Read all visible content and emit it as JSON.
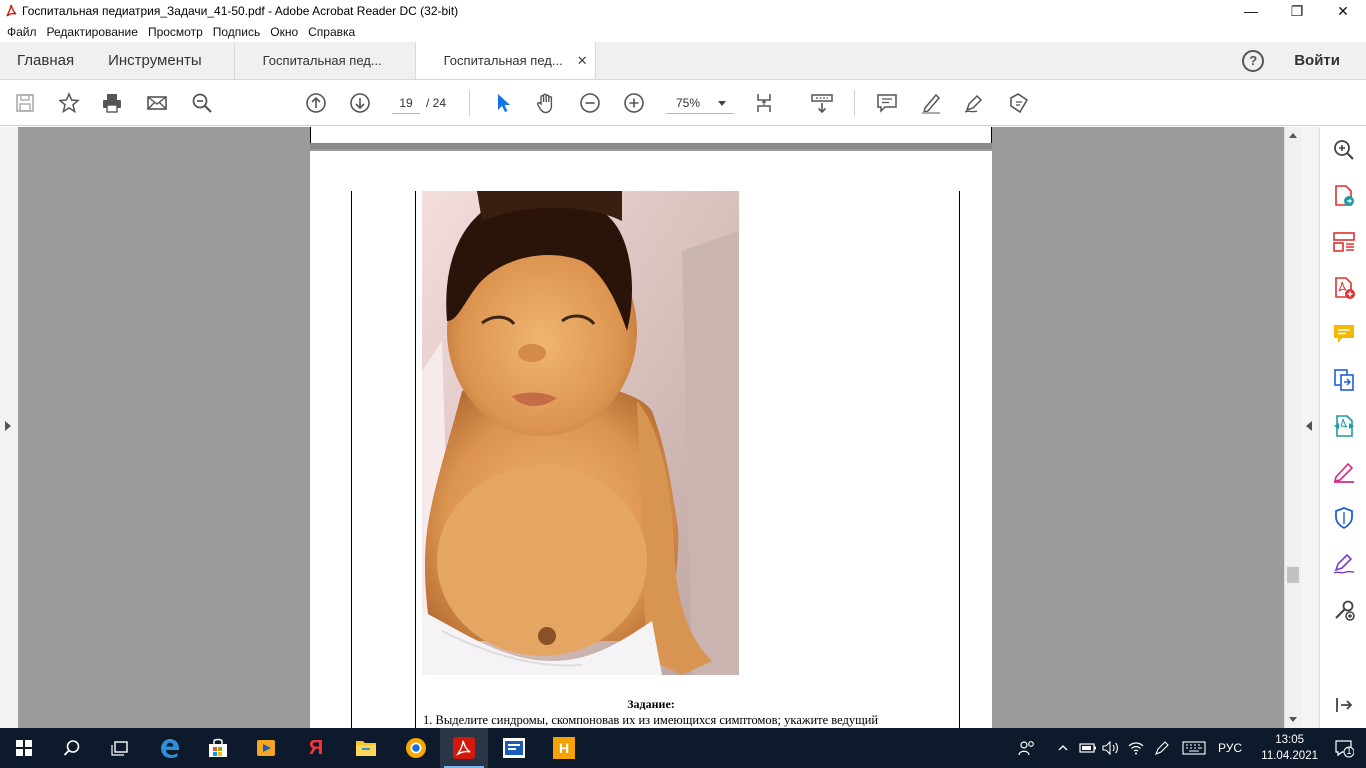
{
  "window": {
    "title": "Госпитальная педиатрия_Задачи_41-50.pdf - Adobe Acrobat Reader DC (32-bit)",
    "minimize": "—",
    "restore": "❐",
    "close": "✕"
  },
  "menu": [
    "Файл",
    "Редактирование",
    "Просмотр",
    "Подпись",
    "Окно",
    "Справка"
  ],
  "tabs": {
    "home": "Главная",
    "tools": "Инструменты",
    "doc1": "Госпитальная пед...",
    "doc2": "Госпитальная пед...",
    "close": "✕",
    "help": "?",
    "signin": "Войти"
  },
  "toolbar": {
    "page_current": "19",
    "page_total": "/   24",
    "zoom": "75%"
  },
  "document": {
    "task_title": "Задание:",
    "task_line1": "1. Выделите синдромы, скомпоновав их из имеющихся симптомов; укажите ведущий"
  },
  "taskbar": {
    "lang": "РУС",
    "time": "13:05",
    "date": "11.04.2021",
    "notif_count": "1",
    "yandex_label": "Я",
    "app_h_label": "H"
  },
  "colors": {
    "accent_red": "#e03030",
    "teal": "#1e9aa8",
    "acrobat_red": "#d3190b",
    "taskbar": "#0d1a2b"
  }
}
